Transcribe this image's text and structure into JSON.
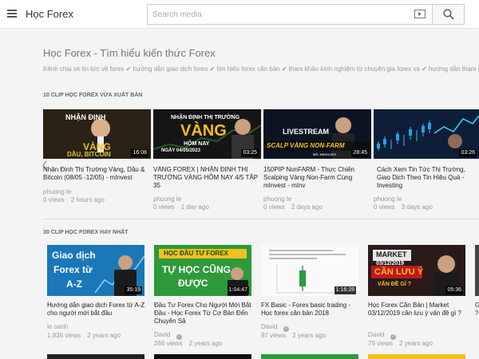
{
  "header": {
    "brand": "Học Forex",
    "search_placeholder": "Search media"
  },
  "page": {
    "title": "Học Forex - Tìm hiểu kiến thức Forex",
    "description": "Kênh chia sẻ tin tức về forex ✔ hướng dẫn giao dịch forex ✔ tìm hiểu forex căn bản ✔ tham khảo kinh nghiệm từ chuyên gia forex và ✔ hướng dẫn tham g"
  },
  "sections": [
    {
      "heading": "10 CLIP HỌC FOREX VỪA XUẤT BẢN",
      "videos": [
        {
          "title": "Nhận Định Thị Trường Vàng, Dầu & Bitcoin (08/05 -12/05) - mInvest",
          "channel": "phuong le",
          "views": "0 views",
          "age": "2 hours ago",
          "duration": "16:08",
          "thumb": {
            "line1": "NHẬN ĐỊNH",
            "line2": "VÀNG",
            "line3": "DẦU, BITCOIN"
          }
        },
        {
          "title": "VÀNG FOREX | NHẬN ĐỊNH THỊ TRƯỜNG VÀNG HÔM NAY 4/5 TẬP 35",
          "channel": "phuong le",
          "views": "0 views",
          "age": "1 day ago",
          "duration": "03:25",
          "thumb": {
            "line1": "NHẬN ĐỊNH THỊ TRƯỜNG",
            "line2": "VÀNG",
            "line3": "HÔM NAY",
            "line4": "NGÀY 04/05/2023"
          }
        },
        {
          "title": "150PIP NonFARM - Thực Chiến Scalping Vàng Non-Farm Cùng mInvest - mInv",
          "channel": "phuong le",
          "views": "0 views",
          "age": "2 days ago",
          "duration": "28:45",
          "thumb": {
            "line1": "LIVESTREAM",
            "line2": "SCALP VÀNG NON-FARM",
            "line3": "MR. MINGLEEZ"
          }
        },
        {
          "title": "Cách Xem Tin Tức Thị Trường, Giao Dịch Theo Tin Hiệu Quả - Investing",
          "channel": "phuong le",
          "views": "0 views",
          "age": "3 days ago",
          "duration": "03:26"
        }
      ]
    },
    {
      "heading": "30 CLIP HỌC FOREX HAY NHẤT",
      "videos": [
        {
          "title": "Hướng dẫn giao dịch Forex từ A-Z cho người mới bắt đầu",
          "channel": "le oanh",
          "views": "1,836 views",
          "age": "2 years ago",
          "duration": "35:19",
          "thumb": {
            "line1": "Giao dịch",
            "line2": "Forex từ",
            "line3": "A-Z"
          }
        },
        {
          "title": "Đầu Tư Forex Cho Người Mới Bắt Đầu - Học Forex Từ Cơ Bản Đến Chuyên Sâ",
          "channel": "David",
          "views": "266 views",
          "age": "2 years ago",
          "duration": "1:04:47",
          "thumb": {
            "line1": "HỌC ĐẦU TƯ FOREX",
            "line2": "TỰ HỌC CŨNG",
            "line3": "ĐƯỢC"
          }
        },
        {
          "title": "FX Basic - Forex basic trading - Học forex căn bản 2018",
          "channel": "David",
          "views": "97 views",
          "age": "2 years ago",
          "duration": "1:16:28"
        },
        {
          "title": "Học Forex Căn Bản | Market 03/12/2019 cần lưu ý vấn đề gì ?",
          "channel": "David",
          "views": "79 views",
          "age": "2 years ago",
          "duration": "05:36",
          "thumb": {
            "line1": "MARKET",
            "line2": "03/12/2019",
            "line3": "CẦN LƯU Ý",
            "line4": "VẤN ĐỀ GÌ ?"
          }
        },
        {
          "title": "G",
          "line2": "?"
        }
      ]
    }
  ],
  "colors": {
    "accent": "#2aa0e0",
    "gold": "#f0c020",
    "green": "#2e9a3a"
  }
}
